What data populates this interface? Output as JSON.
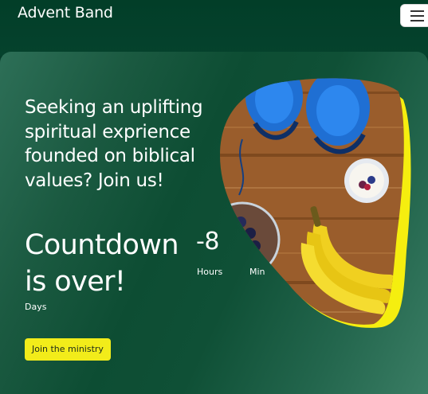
{
  "header": {
    "brand": "Advent Band",
    "menu_icon": "hamburger-menu-icon"
  },
  "hero": {
    "headline": "Seeking an uplifting spiritual exprience founded on biblical values? Join us!",
    "countdown_status": "Countdown is over!",
    "hours_value": "-8",
    "units": {
      "days": "Days",
      "hours": "Hours",
      "minutes": "Min"
    },
    "cta_label": "Join the ministry",
    "image_subject": "sneakers, bananas, yogurt and blueberries on wooden table"
  },
  "colors": {
    "header_bg": "#023e28",
    "card_green": "#0d4d33",
    "accent_yellow": "#f2ec1a",
    "text": "#ffffff"
  }
}
